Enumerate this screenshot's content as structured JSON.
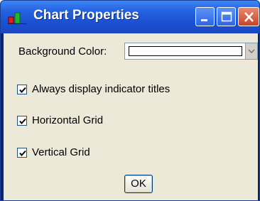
{
  "window": {
    "title": "Chart Properties",
    "title_color": "#ffffff",
    "titlebar_color": "#1b4fd0",
    "client_bg": "#ece9d8"
  },
  "title_buttons": {
    "minimize": "minimize-icon",
    "maximize": "maximize-icon",
    "close": "close-icon"
  },
  "background_color": {
    "label": "Background Color:",
    "value_color": "#ffffff"
  },
  "checkboxes": [
    {
      "label": "Always display indicator titles",
      "checked": true
    },
    {
      "label": "Horizontal Grid",
      "checked": true
    },
    {
      "label": "Vertical Grid",
      "checked": true
    }
  ],
  "ok_button": {
    "label": "OK"
  }
}
